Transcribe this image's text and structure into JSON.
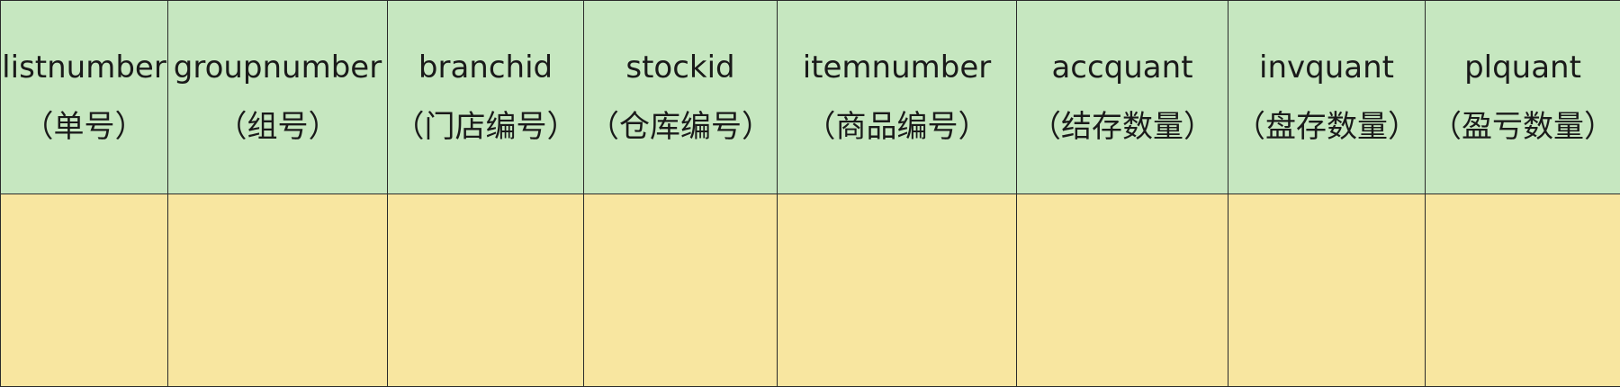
{
  "table": {
    "columns": [
      {
        "name": "listnumber",
        "desc": "（单号）"
      },
      {
        "name": "groupnumber",
        "desc": "（组号）"
      },
      {
        "name": "branchid",
        "desc": "（门店编号）"
      },
      {
        "name": "stockid",
        "desc": "（仓库编号）"
      },
      {
        "name": "itemnumber",
        "desc": "（商品编号）"
      },
      {
        "name": "accquant",
        "desc": "（结存数量）"
      },
      {
        "name": "invquant",
        "desc": "（盘存数量）"
      },
      {
        "name": "plquant",
        "desc": "（盈亏数量）"
      }
    ],
    "rows": [
      [
        "",
        "",
        "",
        "",
        "",
        "",
        "",
        ""
      ]
    ],
    "colors": {
      "header_bg": "#c6e7c0",
      "body_bg": "#f8e6a0",
      "border": "#2a2a2a"
    }
  }
}
